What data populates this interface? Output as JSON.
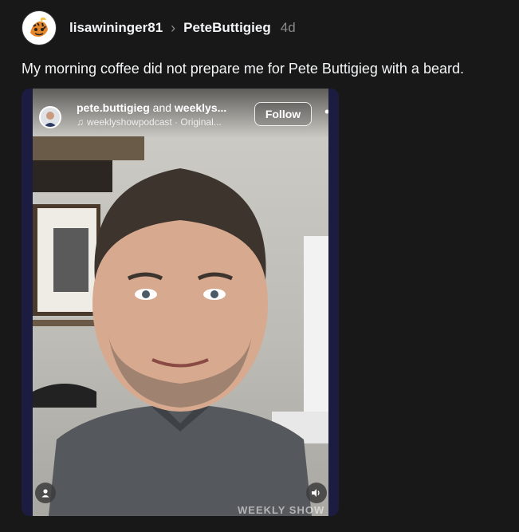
{
  "post": {
    "author": "lisawininger81",
    "reply_to": "PeteButtigieg",
    "time": "4d",
    "caption": "My morning coffee did not prepare me for Pete Buttigieg with a beard."
  },
  "reel": {
    "account": "pete.buttigieg",
    "and_text": "and",
    "collab": "weeklys...",
    "audio": "weeklyshowpodcast · Original...",
    "follow_label": "Follow",
    "more_icon": "more-icon",
    "profile_icon": "user-icon",
    "sound_icon": "speaker-icon",
    "watermark": "WEEKLY SHOW"
  }
}
